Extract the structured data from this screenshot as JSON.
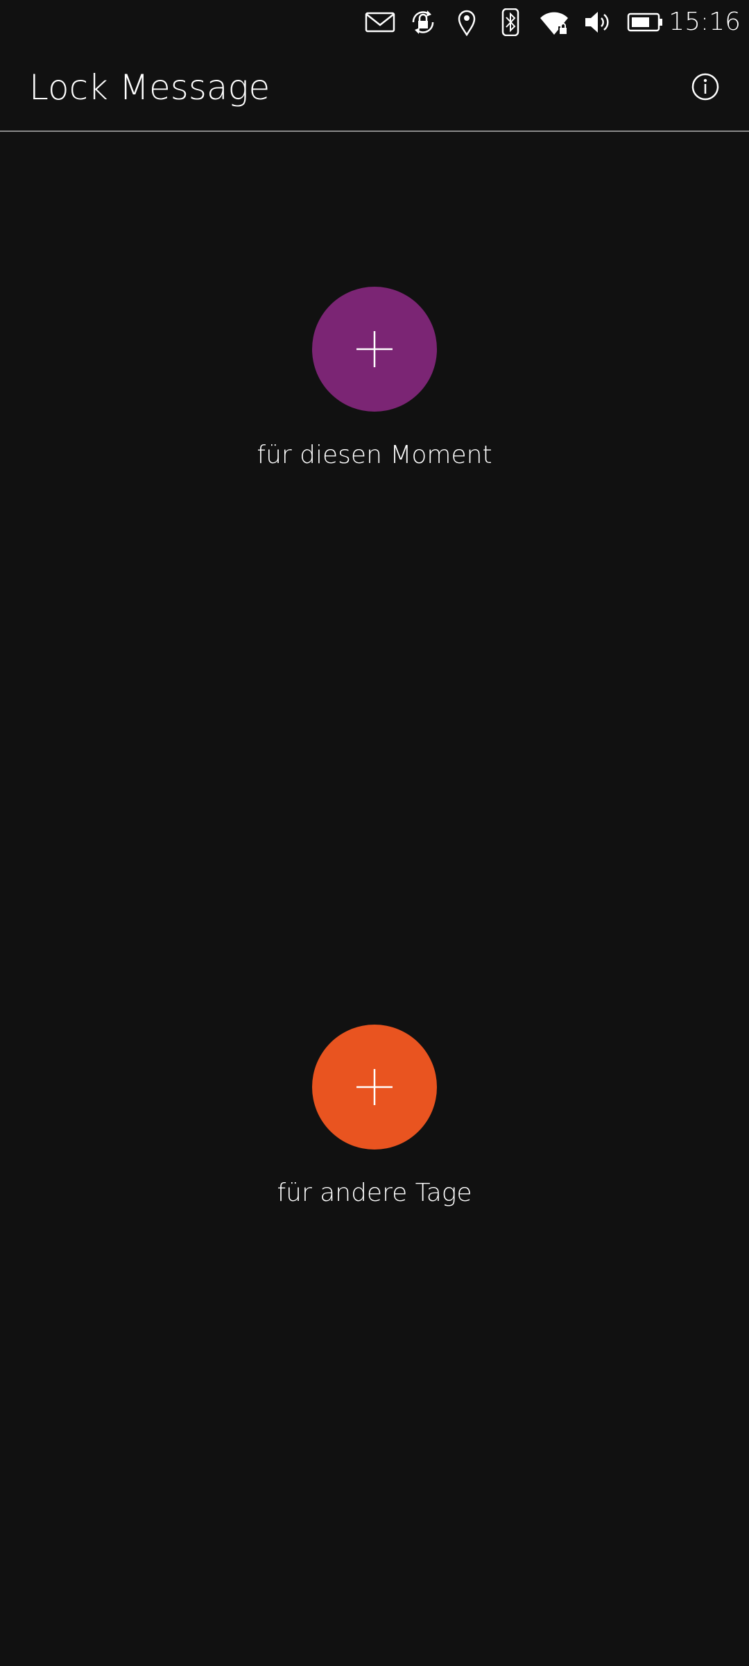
{
  "status_bar": {
    "icons": [
      "mail-icon",
      "rotation-lock-icon",
      "location-icon",
      "bluetooth-icon",
      "wifi-locked-icon",
      "volume-icon",
      "battery-icon"
    ],
    "time": "15:16"
  },
  "header": {
    "title": "Lock Message",
    "info_icon": "info-icon"
  },
  "actions": [
    {
      "label": "für diesen Moment",
      "icon": "plus-icon",
      "color": "#7b2574"
    },
    {
      "label": "für andere Tage",
      "icon": "plus-icon",
      "color": "#e95420"
    }
  ],
  "colors": {
    "background": "#111111",
    "text": "#ffffff",
    "divider": "#8a8a8a"
  }
}
